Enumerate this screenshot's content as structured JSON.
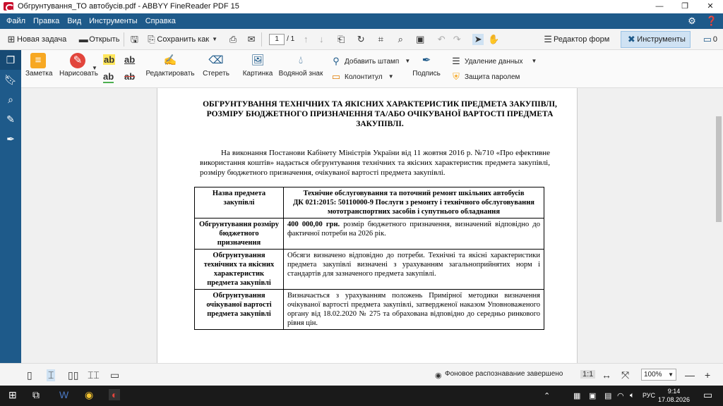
{
  "window": {
    "title": "Обгрунтування_ТО автобусів.pdf - ABBYY FineReader PDF 15",
    "controls": {
      "minimize": "—",
      "maximize": "❐",
      "close": "✕"
    }
  },
  "menu": {
    "items": [
      "Файл",
      "Правка",
      "Вид",
      "Инструменты",
      "Справка"
    ],
    "settings_icon": "gear-icon",
    "help_icon": "help-icon"
  },
  "toolbar": {
    "new_task": "Новая задача",
    "open": "Открыть",
    "save_as": "Сохранить как",
    "page_current": "1",
    "page_total": "/ 1",
    "form_editor": "Редактор форм",
    "tools": "Инструменты",
    "comments_count": "0"
  },
  "ribbon": {
    "note": "Заметка",
    "draw": "Нарисовать",
    "edit": "Редактировать",
    "erase": "Стереть",
    "picture": "Картинка",
    "watermark": "Водяной знак",
    "add_stamp": "Добавить штамп",
    "header_footer": "Колонтитул",
    "signature": "Подпись",
    "remove_data": "Удаление данных",
    "password": "Защита паролем",
    "ab1": "ab",
    "ab2": "ab",
    "ab3": "ab",
    "ab4": "ab"
  },
  "document": {
    "title": "ОБГРУНТУВАННЯ ТЕХНІЧНИХ ТА ЯКІСНИХ ХАРАКТЕРИСТИК ПРЕДМЕТА ЗАКУПІВЛІ, РОЗМІРУ БЮДЖЕТНОГО ПРИЗНАЧЕННЯ ТА/АБО ОЧІКУВАНОЇ ВАРТОСТІ ПРЕДМЕТА ЗАКУПІВЛІ.",
    "paragraph": "На виконання Постанови Кабінету Міністрів України від 11 жовтня 2016 р. №710 «Про ефективне використання коштів» надається обгрунтування технічних та якісних характеристик предмета закупівлі, розміру бюджетного призначення, очікуваної вартості предмета закупівлі.",
    "table": {
      "header_left": "Назва предмета закупівлі",
      "header_right_1": "Технічне обслуговування та поточний ремонт шкільних автобусів",
      "header_right_2": "ДК 021:2015: 50110000-9 Послуги з ремонту і технічного обслуговування мототранспортних засобів і супутнього обладнання",
      "rows": [
        {
          "label": "Обгрунтування розміру бюджетного призначення",
          "value_bold": "400 000,00 грн.",
          "value": " розмір бюджетного призначення, визначений відповідно до фактичної потреби на 2026 рік."
        },
        {
          "label": "Обгрунтування технічних та якісних характеристик предмета закупівлі",
          "value_bold": "",
          "value": "Обсяги визначено відповідно до потреби. Технічні та якісні характеристики предмета закупівлі визначені з урахуванням загальноприйнятих норм і стандартів для зазначеного предмета закупівлі."
        },
        {
          "label": "Обгрунтування очікуваної вартості предмета закупівлі",
          "value_bold": "",
          "value": "Визначається з урахуванням положень Примірної методики визначення очікуваної вартості предмета закупівлі, затвердженої наказом Уповноваженого органу від 18.02.2020 № 275 та обрахована відповідно до середньо ринкового рівня цін."
        }
      ]
    }
  },
  "status": {
    "recognition": "Фоновое распознавание завершено",
    "ratio": "1:1",
    "zoom": "100%",
    "minus": "—",
    "plus": "+"
  },
  "taskbar": {
    "lang": "РУС",
    "time": "9:14",
    "date": "17.08.2026"
  },
  "colors": {
    "menu_bg": "#1e5a8a",
    "accent": "#c8102e"
  }
}
